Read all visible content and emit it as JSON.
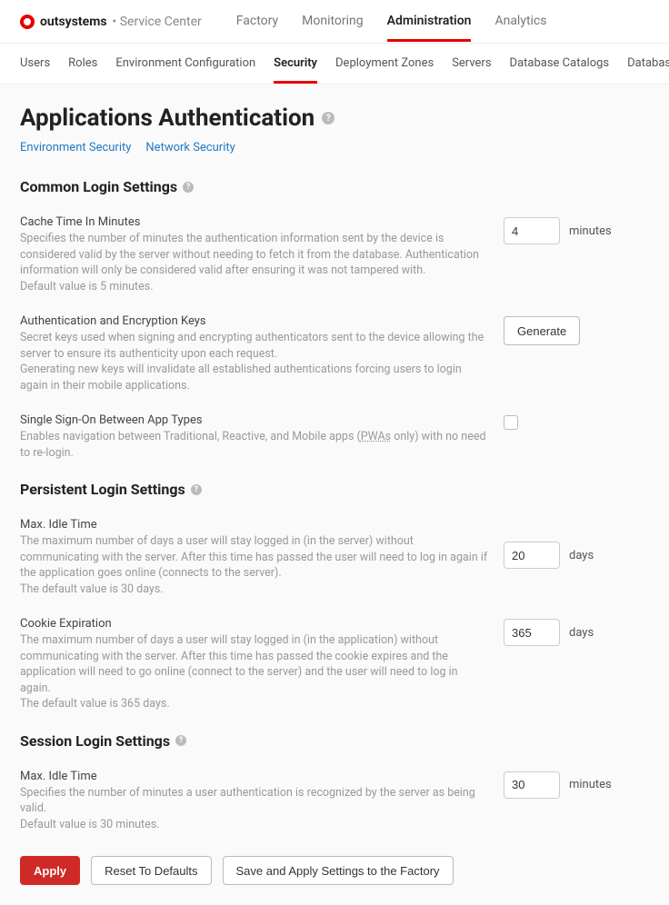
{
  "brand": {
    "name": "outsystems",
    "sub": "• Service Center"
  },
  "topnav": [
    {
      "label": "Factory",
      "active": false
    },
    {
      "label": "Monitoring",
      "active": false
    },
    {
      "label": "Administration",
      "active": true
    },
    {
      "label": "Analytics",
      "active": false
    }
  ],
  "subnav": [
    {
      "label": "Users",
      "active": false
    },
    {
      "label": "Roles",
      "active": false
    },
    {
      "label": "Environment Configuration",
      "active": false
    },
    {
      "label": "Security",
      "active": true
    },
    {
      "label": "Deployment Zones",
      "active": false
    },
    {
      "label": "Servers",
      "active": false
    },
    {
      "label": "Database Catalogs",
      "active": false
    },
    {
      "label": "Database Connections",
      "active": false
    }
  ],
  "page": {
    "title": "Applications Authentication",
    "sublinks": [
      "Environment Security",
      "Network Security"
    ]
  },
  "sections": {
    "common": {
      "heading": "Common Login Settings",
      "cache": {
        "label": "Cache Time In Minutes",
        "desc": "Specifies the number of minutes the authentication information sent by the device is considered valid by the server without needing to fetch it from the database. Authentication information will only be considered valid after ensuring it was not tampered with.\nDefault value is 5 minutes.",
        "value": "4",
        "unit": "minutes"
      },
      "keys": {
        "label": "Authentication and Encryption Keys",
        "desc": "Secret keys used when signing and encrypting authenticators sent to the device allowing the server to ensure its authenticity upon each request.\nGenerating new keys will invalidate all established authentications forcing users to login again in their mobile applications.",
        "button": "Generate"
      },
      "sso": {
        "label": "Single Sign-On Between App Types",
        "desc_pre": "Enables navigation between Traditional, Reactive, and Mobile apps (",
        "desc_pwas": "PWAs",
        "desc_post": " only) with no need to re-login.",
        "checked": false
      }
    },
    "persistent": {
      "heading": "Persistent Login Settings",
      "idle": {
        "label": "Max. Idle Time",
        "desc": "The maximum number of days a user will stay logged in (in the server) without communicating with the server. After this time has passed the user will need to log in again if the application goes online (connects to the server).\nThe default value is 30 days.",
        "value": "20",
        "unit": "days"
      },
      "cookie": {
        "label": "Cookie Expiration",
        "desc": "The maximum number of days a user will stay logged in (in the application) without communicating with the server. After this time has passed the cookie expires and the application will need to go online (connect to the server) and the user will need to log in again.\nThe default value is 365 days.",
        "value": "365",
        "unit": "days"
      }
    },
    "session": {
      "heading": "Session Login Settings",
      "idle": {
        "label": "Max. Idle Time",
        "desc": "Specifies the number of minutes a user authentication is recognized by the server as being valid.\nDefault value is 30 minutes.",
        "value": "30",
        "unit": "minutes"
      }
    }
  },
  "actions": {
    "apply": "Apply",
    "reset": "Reset To Defaults",
    "saveFactory": "Save and Apply Settings to the Factory"
  }
}
